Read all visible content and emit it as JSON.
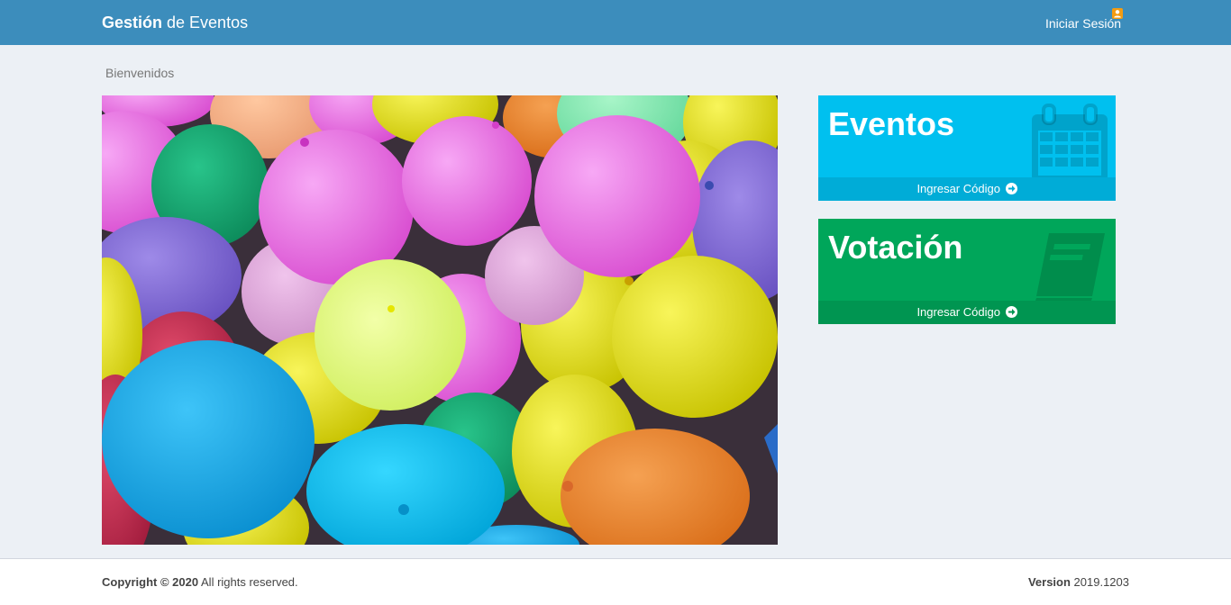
{
  "header": {
    "brand_bold": "Gestión",
    "brand_rest": " de Eventos",
    "login_label": "Iniciar Sesión",
    "login_icon": "user-icon"
  },
  "breadcrumb": "Bienvenidos",
  "tiles": [
    {
      "title": "Eventos",
      "footer_label": "Ingresar Código",
      "icon": "calendar-icon",
      "color": "#00c0ef"
    },
    {
      "title": "Votación",
      "footer_label": "Ingresar Código",
      "icon": "book-icon",
      "color": "#00a65a"
    }
  ],
  "footer": {
    "copyright_bold": "Copyright © 2020",
    "copyright_rest": " All rights reserved.",
    "version_bold": "Version",
    "version_number": " 2019.1203"
  },
  "colors": {
    "header": "#3c8dbc",
    "background": "#ecf0f5"
  }
}
